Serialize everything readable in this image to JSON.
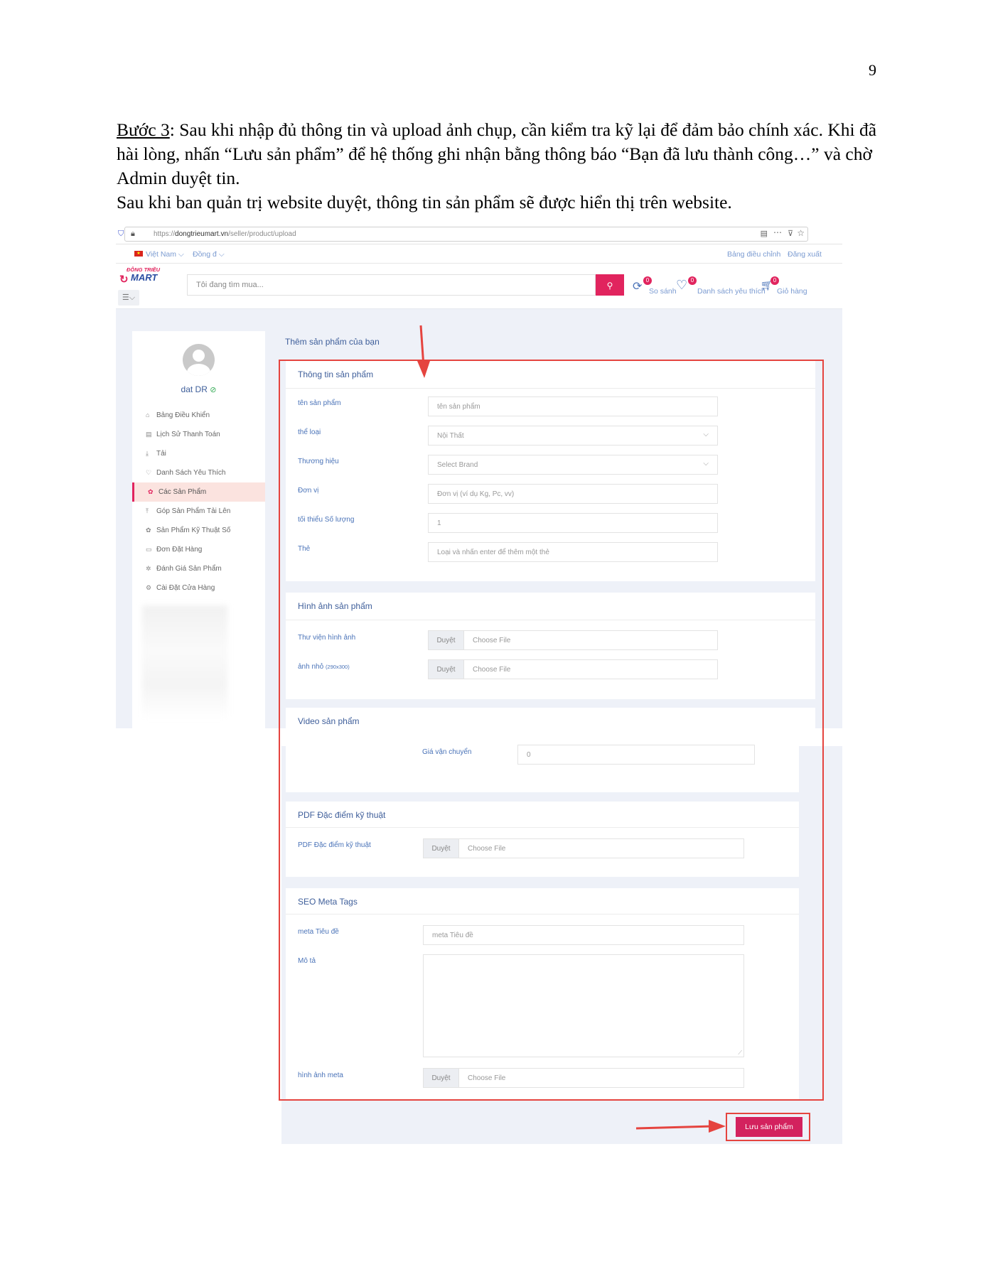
{
  "page_number": "9",
  "doc": {
    "para1_underlined": "Bước 3",
    "para1_rest": ": Sau khi nhập đủ thông tin và upload ảnh chụp, cần kiểm tra kỹ lại để đảm bảo chính xác. Khi đã hài lòng, nhấn “Lưu sản phẩm” để hệ thống ghi nhận bằng thông báo “Bạn đã lưu thành công…” và chờ Admin duyệt tin.",
    "para2": "Sau khi ban quản trị website duyệt, thông tin sản phẩm sẽ được hiển thị trên website."
  },
  "browser": {
    "url_prefix": "https://",
    "url_domain": "dongtrieumart.vn",
    "url_path": "/seller/product/upload"
  },
  "top_strip": {
    "language": "Việt Nam",
    "currency": "Đồng đ",
    "dashboard_link": "Bảng điều chỉnh",
    "logout_link": "Đăng xuất"
  },
  "header": {
    "logo_line1": "ĐÔNG TRIỀU",
    "logo_line2": "MART",
    "search_placeholder": "Tôi đang tìm mua...",
    "compare_label": "So sánh",
    "compare_count": "0",
    "wishlist_label": "Danh sách yêu thích",
    "wishlist_count": "0",
    "cart_label": "Giỏ hàng",
    "cart_count": "0"
  },
  "sidebar": {
    "user_name": "dat DR",
    "items": [
      {
        "label": "Bảng Điều Khiển",
        "icon": "⌂"
      },
      {
        "label": "Lịch Sử Thanh Toán",
        "icon": "▤"
      },
      {
        "label": "Tải",
        "icon": "⤓"
      },
      {
        "label": "Danh Sách Yêu Thích",
        "icon": "♡"
      },
      {
        "label": "Các Sản Phẩm",
        "icon": "✿"
      },
      {
        "label": "Góp Sản Phẩm Tải Lên",
        "icon": "⤒"
      },
      {
        "label": "Sản Phẩm Kỹ Thuật Số",
        "icon": "✿"
      },
      {
        "label": "Đơn Đặt Hàng",
        "icon": "▭"
      },
      {
        "label": "Đánh Giá Sản Phẩm",
        "icon": "✲"
      },
      {
        "label": "Cài Đặt Cửa Hàng",
        "icon": "⚙"
      }
    ]
  },
  "main": {
    "heading": "Thêm sản phẩm của bạn",
    "product_info": {
      "title": "Thông tin sản phẩm",
      "name_label": "tên sản phẩm",
      "name_placeholder": "tên sản phẩm",
      "category_label": "thể loại",
      "category_value": "Nội Thất",
      "brand_label": "Thương hiệu",
      "brand_value": "Select Brand",
      "unit_label": "Đơn vị",
      "unit_placeholder": "Đơn vị (ví dụ Kg, Pc, vv)",
      "min_qty_label": "tối thiểu Số lượng",
      "min_qty_value": "1",
      "tags_label": "Thẻ",
      "tags_placeholder": "Loại và nhấn enter để thêm một thẻ"
    },
    "images": {
      "title": "Hình ảnh sản phẩm",
      "gallery_label": "Thư viện hình ảnh",
      "thumb_label": "ảnh nhỏ",
      "thumb_hint": "(290x300)",
      "browse": "Duyệt",
      "choose_file": "Choose File"
    },
    "video": {
      "title": "Video sản phẩm",
      "shipping_label": "Giá vận chuyển",
      "shipping_value": "0"
    },
    "pdf": {
      "title": "PDF Đặc điểm kỹ thuật",
      "field_label": "PDF Đặc điểm kỹ thuật",
      "browse": "Duyệt",
      "choose_file": "Choose File"
    },
    "seo": {
      "title": "SEO Meta Tags",
      "meta_title_label": "meta Tiêu đề",
      "meta_title_placeholder": "meta Tiêu đề",
      "desc_label": "Mô tả",
      "meta_image_label": "hình ảnh meta",
      "browse": "Duyệt",
      "choose_file": "Choose File"
    },
    "save_button": "Lưu sản phẩm"
  },
  "colors": {
    "accent": "#e1245e",
    "annotation_red": "#e5443f",
    "label_blue": "#4a73b8",
    "page_bg": "#eef1f8"
  }
}
